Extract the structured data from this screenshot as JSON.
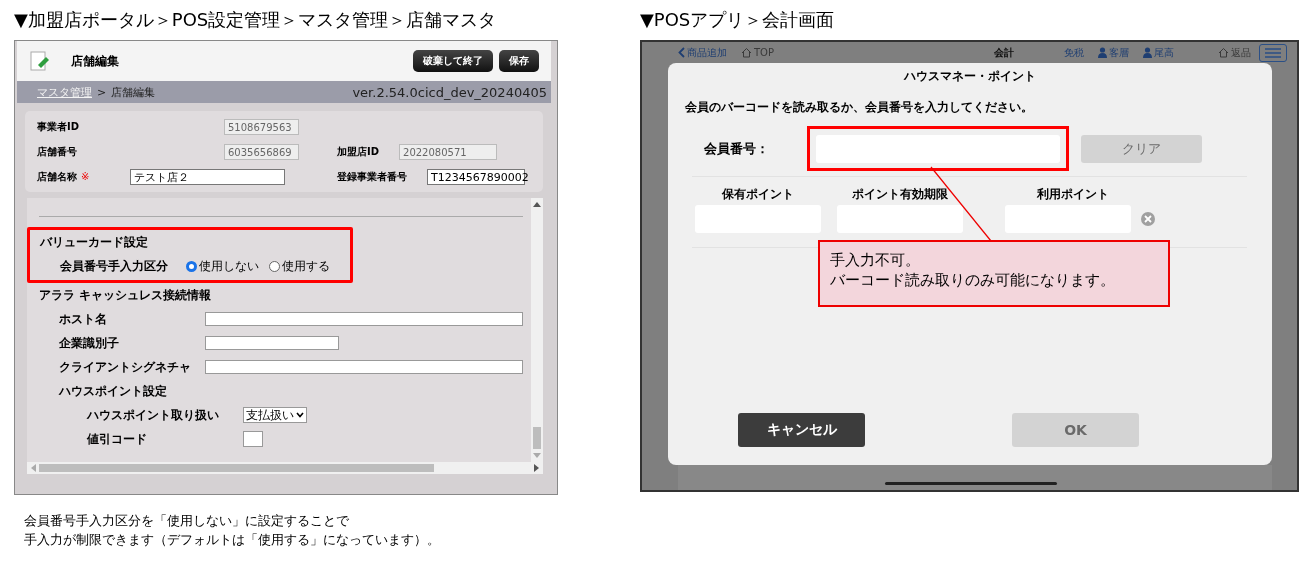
{
  "left": {
    "heading": "▼加盟店ポータル＞POS設定管理＞マスタ管理＞店舗マスタ",
    "title": "店舗編集",
    "buttons": [
      "破棄して終了",
      "保存"
    ],
    "breadcrumb": {
      "link": "マスタ管理",
      "separator": ">",
      "current": "店舗編集"
    },
    "version": "ver.2.54.0cicd_dev_20240405",
    "info_rows": [
      [
        {
          "label": "事業者ID",
          "value": "5108679563",
          "editable": false
        }
      ],
      [
        {
          "label": "店舗番号",
          "value": "6035656869",
          "editable": false
        },
        {
          "label": "加盟店ID",
          "value": "2022080571",
          "editable": false
        }
      ],
      [
        {
          "label": "店舗名称",
          "required_mark": "※",
          "value": "テスト店２",
          "editable": true
        },
        {
          "label": "登録事業者番号",
          "value": "T1234567890002",
          "editable": true
        }
      ]
    ],
    "value_card": {
      "title": "バリューカード設定",
      "highlighted": true,
      "field": "会員番号手入力区分",
      "options": [
        {
          "label": "使用しない",
          "selected": true
        },
        {
          "label": "使用する",
          "selected": false
        }
      ]
    },
    "cashless": {
      "title": "アララ キャッシュレス接続情報",
      "fields": [
        {
          "label": "ホスト名",
          "kind": "wide"
        },
        {
          "label": "企業識別子",
          "kind": "short"
        },
        {
          "label": "クライアントシグネチャ",
          "kind": "wide"
        }
      ]
    },
    "house_point": {
      "title": "ハウスポイント設定",
      "fields": [
        {
          "label": "ハウスポイント取り扱い",
          "kind": "select",
          "value": "支払扱い"
        },
        {
          "label": "値引コード",
          "kind": "tiny"
        }
      ]
    },
    "caption": [
      "会員番号手入力区分を「使用しない」に設定することで",
      "手入力が制限できます（デフォルトは「使用する」になっています）。"
    ]
  },
  "right": {
    "heading": "▼POSアプリ＞会計画面",
    "nav_left": [
      {
        "label": "商品追加",
        "kind": "back",
        "disabled": false
      },
      {
        "label": "TOP",
        "kind": "home",
        "disabled": true
      }
    ],
    "nav_title": "会計",
    "nav_right": [
      {
        "label": "免税",
        "kind": "text",
        "disabled": false
      },
      {
        "label": "客層",
        "kind": "person",
        "disabled": false
      },
      {
        "label": "尾高",
        "kind": "person",
        "disabled": false
      },
      {
        "label": "返品",
        "kind": "home",
        "disabled": true
      }
    ],
    "dialog": {
      "title": "ハウスマネー・ポイント",
      "instruction": "会員のバーコードを読み取るか、会員番号を入力してください。",
      "member": {
        "label": "会員番号：",
        "highlighted": true
      },
      "clear_button": {
        "label": "クリア",
        "disabled": true
      },
      "points": [
        {
          "label": "保有ポイント",
          "clearable": false
        },
        {
          "label": "ポイント有効期限",
          "clearable": false
        },
        {
          "label": "利用ポイント",
          "clearable": true
        }
      ],
      "callout": [
        "手入力不可。",
        "バーコード読み取りのみ可能になります。"
      ],
      "buttons": [
        {
          "label": "キャンセル",
          "disabled": false
        },
        {
          "label": "OK",
          "disabled": true
        }
      ]
    }
  }
}
